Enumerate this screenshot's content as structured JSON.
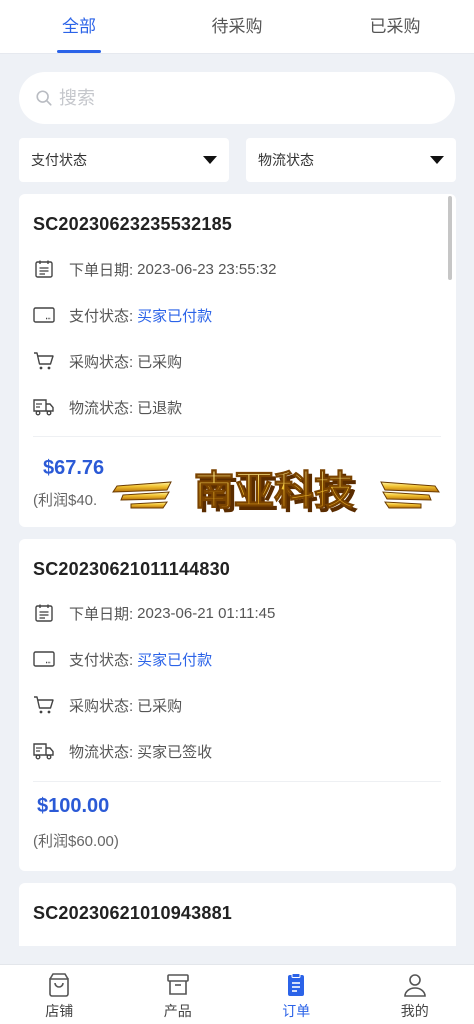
{
  "tabs": [
    {
      "label": "全部",
      "active": true
    },
    {
      "label": "待采购",
      "active": false
    },
    {
      "label": "已采购",
      "active": false
    }
  ],
  "search": {
    "placeholder": "搜索",
    "value": ""
  },
  "filters": {
    "payment": {
      "label": "支付状态"
    },
    "logistics": {
      "label": "物流状态"
    }
  },
  "orders": [
    {
      "id": "SC20230623235532185",
      "date_label": "下单日期:",
      "date_value": "2023-06-23 23:55:32",
      "pay_label": "支付状态:",
      "pay_value": "买家已付款",
      "purchase_label": "采购状态:",
      "purchase_value": "已采购",
      "logistics_label": "物流状态:",
      "logistics_value": "已退款",
      "price": "$67.76",
      "profit": "(利润$40.",
      "watermark": "南亚科技"
    },
    {
      "id": "SC20230621011144830",
      "date_label": "下单日期:",
      "date_value": "2023-06-21 01:11:45",
      "pay_label": "支付状态:",
      "pay_value": "买家已付款",
      "purchase_label": "采购状态:",
      "purchase_value": "已采购",
      "logistics_label": "物流状态:",
      "logistics_value": "买家已签收",
      "price": "$100.00",
      "profit": "(利润$60.00)"
    },
    {
      "id": "SC20230621010943881"
    }
  ],
  "bottom_nav": [
    {
      "label": "店铺",
      "icon": "shopping-bag-icon",
      "active": false
    },
    {
      "label": "产品",
      "icon": "archive-box-icon",
      "active": false
    },
    {
      "label": "订单",
      "icon": "clipboard-list-icon",
      "active": true
    },
    {
      "label": "我的",
      "icon": "user-icon",
      "active": false
    }
  ],
  "colors": {
    "accent": "#2b63e8",
    "price": "#2b5ad6",
    "background": "#eef1f6"
  }
}
